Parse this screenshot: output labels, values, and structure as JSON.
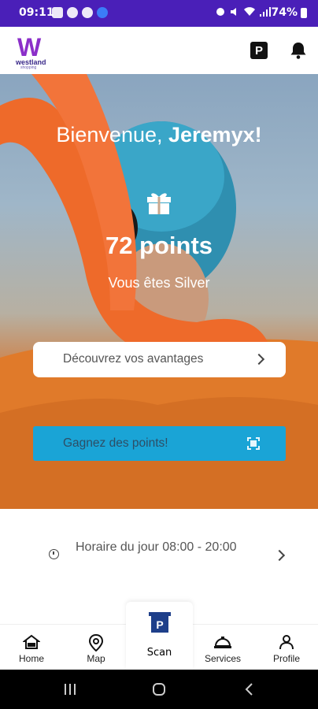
{
  "status_bar": {
    "time": "09:11",
    "battery": "74%"
  },
  "header": {
    "logo_text": "westland",
    "logo_sub": "shopping",
    "parking_label": "P"
  },
  "hero": {
    "welcome_prefix": "Bienvenue, ",
    "user_name": "Jeremyx!",
    "points": "72 points",
    "tier": "Vous êtes Silver",
    "benefits_label": "Découvrez vos avantages",
    "earn_label": "Gagnez des points!"
  },
  "hours": {
    "text": "Horaire du jour 08:00 - 20:00"
  },
  "bottom_nav": {
    "home": "Home",
    "map": "Map",
    "scan": "Scan",
    "services": "Services",
    "profile": "Profile"
  },
  "colors": {
    "status_bar": "#4a1fb8",
    "earn_button": "#1aa4d6",
    "logo_accent": "#8b2fc9"
  }
}
